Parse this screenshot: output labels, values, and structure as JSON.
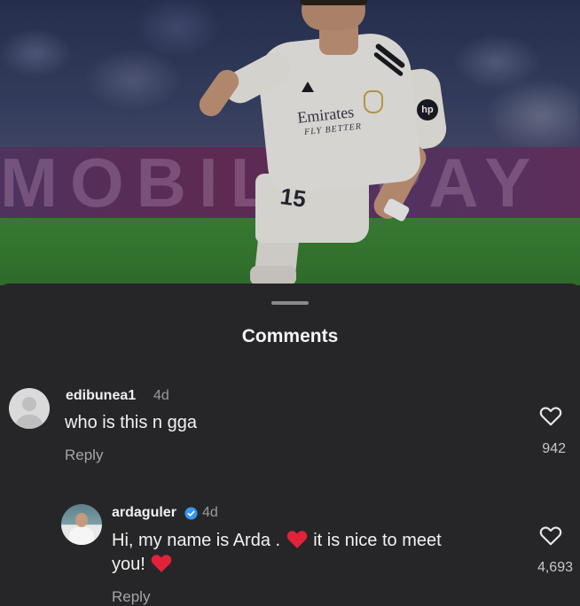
{
  "photo": {
    "banner_text": "MOBILE PAY",
    "sponsor": "Emirates",
    "sponsor_tagline": "FLY BETTER",
    "jersey_number": "15",
    "kit_sponsor": "hp"
  },
  "sheet": {
    "title": "Comments"
  },
  "comments": [
    {
      "username": "edibunea1",
      "time": "4d",
      "text": "who is this n gga",
      "reply_label": "Reply",
      "likes": "942",
      "avatar": "default-avatar-icon"
    },
    {
      "username": "ardaguler",
      "verified": true,
      "time": "4d",
      "text_part1": "Hi, my name is Arda .",
      "text_part2": "it is nice to meet",
      "text_part3": "you!",
      "reply_label": "Reply",
      "likes": "4,693",
      "avatar": "profile-photo"
    }
  ],
  "colors": {
    "background": "#262628",
    "heart_emoji": "#e0223a",
    "verified_badge": "#3797f0"
  }
}
